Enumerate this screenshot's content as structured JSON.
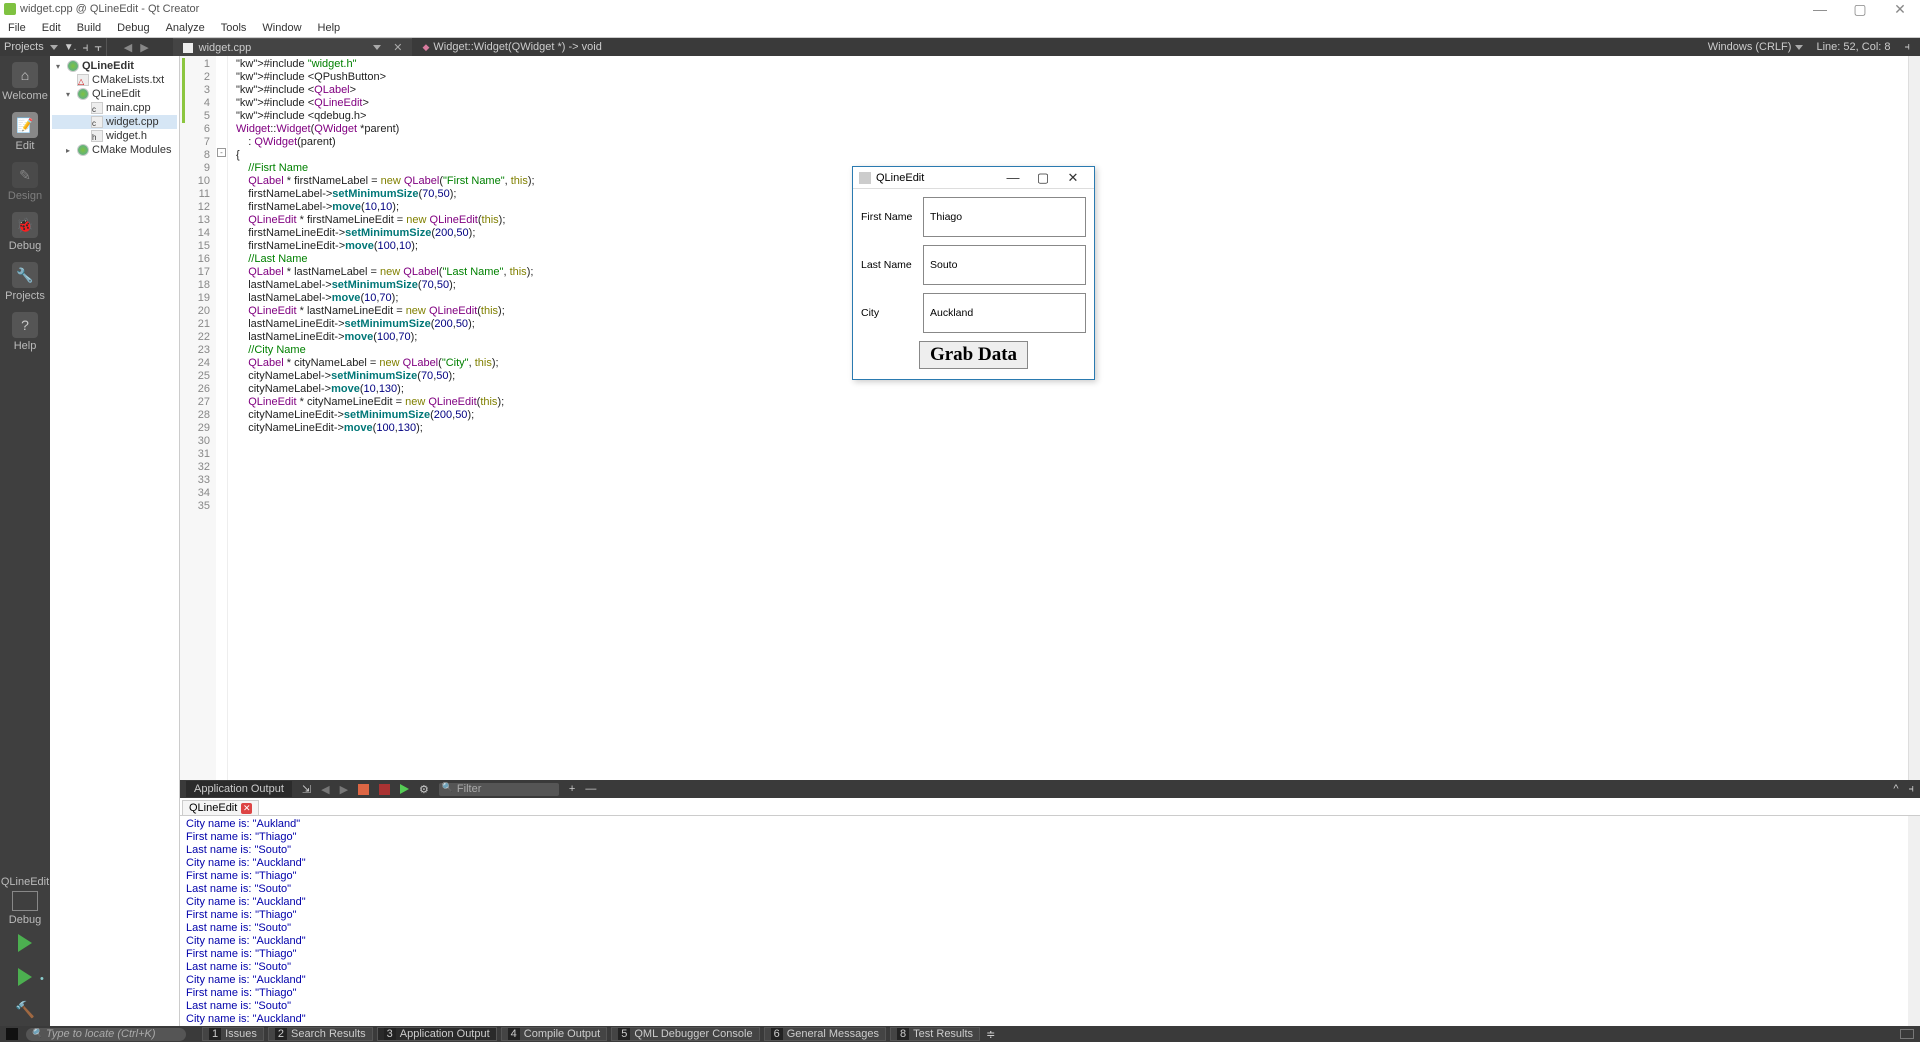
{
  "window": {
    "title": "widget.cpp @ QLineEdit - Qt Creator",
    "min": "—",
    "max": "▢",
    "close": "✕"
  },
  "menu": {
    "file": "File",
    "edit": "Edit",
    "build": "Build",
    "debug": "Debug",
    "analyze": "Analyze",
    "tools": "Tools",
    "window": "Window",
    "help": "Help"
  },
  "toolbar": {
    "projects_label": "Projects",
    "open_tab": "widget.cpp",
    "open_tab_close": "✕",
    "crumb": "Widget::Widget(QWidget *) -> void",
    "encoding": "Windows (CRLF)",
    "linecol": "Line: 52, Col: 8"
  },
  "leftrail": {
    "welcome": "Welcome",
    "edit": "Edit",
    "design": "Design",
    "debug": "Debug",
    "projects": "Projects",
    "help": "Help",
    "target": "QLineEdit",
    "config": "Debug"
  },
  "tree": {
    "root": "QLineEdit",
    "cmakelists": "CMakeLists.txt",
    "sub": "QLineEdit",
    "main": "main.cpp",
    "widgetcpp": "widget.cpp",
    "widgeth": "widget.h",
    "cmakemod": "CMake Modules"
  },
  "code": {
    "lines": [
      "#include \"widget.h\"",
      "#include <QPushButton>",
      "#include <QLabel>",
      "#include <QLineEdit>",
      "#include <qdebug.h>",
      "",
      "Widget::Widget(QWidget *parent)",
      "    : QWidget(parent)",
      "{",
      "    //Fisrt Name",
      "    QLabel * firstNameLabel = new QLabel(\"First Name\", this);",
      "    firstNameLabel->setMinimumSize(70,50);",
      "    firstNameLabel->move(10,10);",
      "",
      "    QLineEdit * firstNameLineEdit = new QLineEdit(this);",
      "    firstNameLineEdit->setMinimumSize(200,50);",
      "    firstNameLineEdit->move(100,10);",
      "",
      "    //Last Name",
      "    QLabel * lastNameLabel = new QLabel(\"Last Name\", this);",
      "    lastNameLabel->setMinimumSize(70,50);",
      "    lastNameLabel->move(10,70);",
      "",
      "    QLineEdit * lastNameLineEdit = new QLineEdit(this);",
      "    lastNameLineEdit->setMinimumSize(200,50);",
      "    lastNameLineEdit->move(100,70);",
      "",
      "    //City Name",
      "    QLabel * cityNameLabel = new QLabel(\"City\", this);",
      "    cityNameLabel->setMinimumSize(70,50);",
      "    cityNameLabel->move(10,130);",
      "",
      "    QLineEdit * cityNameLineEdit = new QLineEdit(this);",
      "    cityNameLineEdit->setMinimumSize(200,50);",
      "    cityNameLineEdit->move(100,130);"
    ]
  },
  "output": {
    "panel_label": "Application Output",
    "filter_placeholder": "Filter",
    "tab": "QLineEdit",
    "lines": [
      "City name is:  \"Aukland\"",
      "First name is:  \"Thiago\"",
      "Last name is:  \"Souto\"",
      "City name is:  \"Auckland\"",
      "First name is:  \"Thiago\"",
      "Last name is:  \"Souto\"",
      "City name is:  \"Auckland\"",
      "First name is:  \"Thiago\"",
      "Last name is:  \"Souto\"",
      "City name is:  \"Auckland\"",
      "First name is:  \"Thiago\"",
      "Last name is:  \"Souto\"",
      "City name is:  \"Auckland\"",
      "First name is:  \"Thiago\"",
      "Last name is:  \"Souto\"",
      "City name is:  \"Auckland\""
    ]
  },
  "status": {
    "locator": "Type to locate (Ctrl+K)",
    "panes": [
      {
        "n": "1",
        "l": "Issues"
      },
      {
        "n": "2",
        "l": "Search Results"
      },
      {
        "n": "3",
        "l": "Application Output"
      },
      {
        "n": "4",
        "l": "Compile Output"
      },
      {
        "n": "5",
        "l": "QML Debugger Console"
      },
      {
        "n": "6",
        "l": "General Messages"
      },
      {
        "n": "8",
        "l": "Test Results"
      }
    ]
  },
  "popup": {
    "title": "QLineEdit",
    "first_label": "First Name",
    "first_val": "Thiago",
    "last_label": "Last Name",
    "last_val": "Souto",
    "city_label": "City",
    "city_val": "Auckland",
    "btn": "Grab Data",
    "min": "—",
    "max": "▢",
    "close": "✕"
  }
}
